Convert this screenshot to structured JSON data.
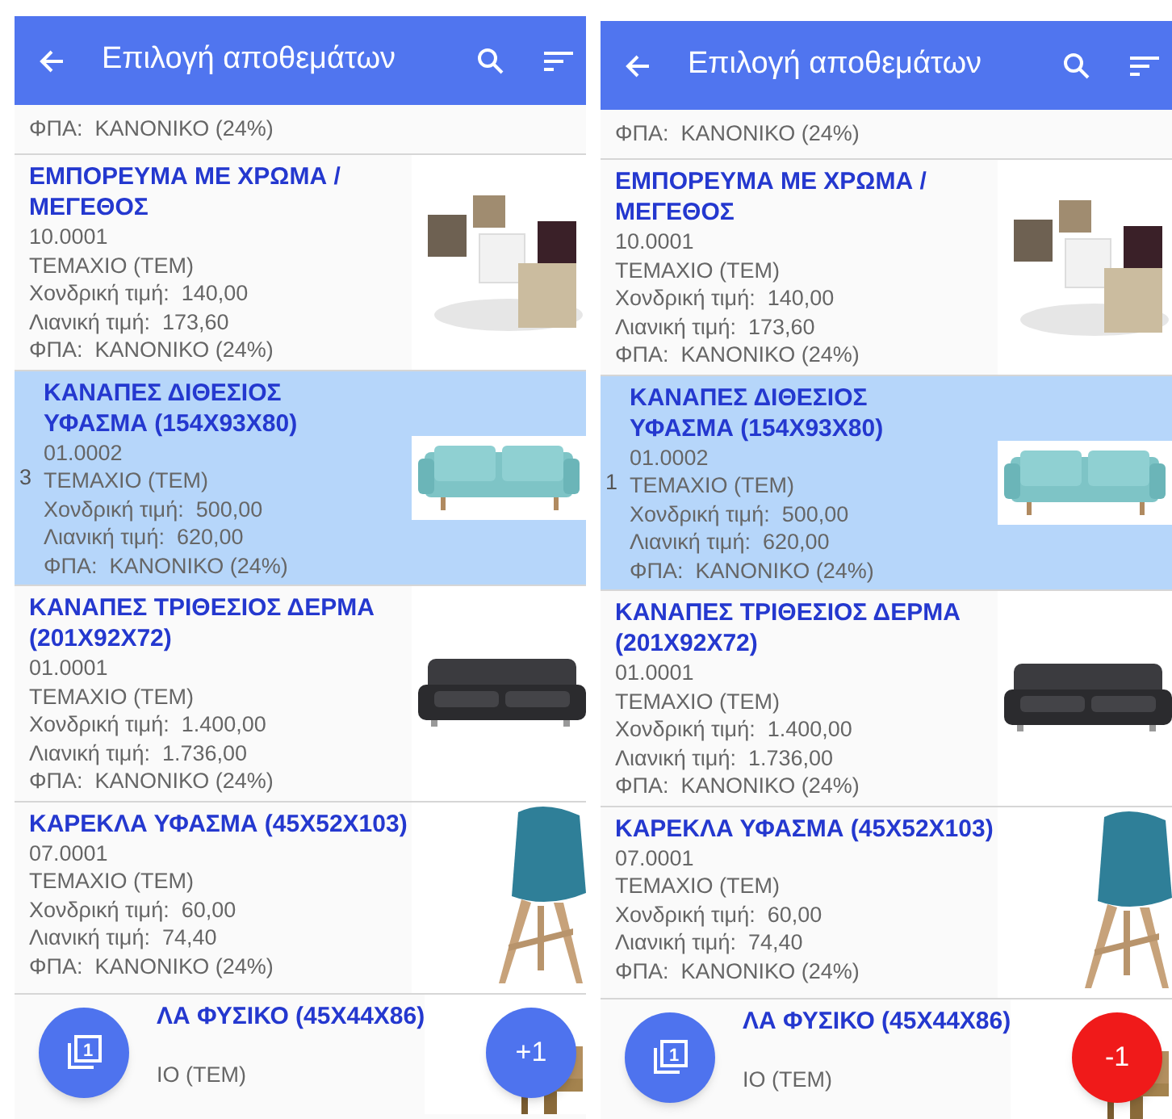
{
  "panels": [
    {
      "title": "Επιλογή αποθεμάτων",
      "top_fragment": "ΦΠΑ:  ΚΑΝΟΝΙΚΟ (24%)",
      "items": [
        {
          "title": "ΕΜΠΟΡΕΥΜΑ ΜΕ ΧΡΩΜΑ / ΜΕΓΕΘΟΣ",
          "code": "10.0001",
          "unit": "ΤΕΜΑΧΙΟ (ΤΕΜ)",
          "wholesale": "Χονδρική τιμή:  140,00",
          "retail": "Λιανική τιμή:  173,60",
          "vat": "ΦΠΑ:  ΚΑΝΟΝΙΚΟ (24%)",
          "selected": false
        },
        {
          "title": "ΚΑΝΑΠΕΣ ΔΙΘΕΣΙΟΣ ΥΦΑΣΜΑ (154X93X80)",
          "code": "01.0002",
          "unit": "ΤΕΜΑΧΙΟ (ΤΕΜ)",
          "wholesale": "Χονδρική τιμή:  500,00",
          "retail": "Λιανική τιμή:  620,00",
          "vat": "ΦΠΑ:  ΚΑΝΟΝΙΚΟ (24%)",
          "selected": true,
          "quantity": "3"
        },
        {
          "title": "ΚΑΝΑΠΕΣ ΤΡΙΘΕΣΙΟΣ ΔΕΡΜΑ (201X92X72)",
          "code": "01.0001",
          "unit": "ΤΕΜΑΧΙΟ (ΤΕΜ)",
          "wholesale": "Χονδρική τιμή:  1.400,00",
          "retail": "Λιανική τιμή:  1.736,00",
          "vat": "ΦΠΑ:  ΚΑΝΟΝΙΚΟ (24%)",
          "selected": false
        },
        {
          "title": "ΚΑΡΕΚΛΑ ΥΦΑΣΜΑ (45X52X103)",
          "code": "07.0001",
          "unit": "ΤΕΜΑΧΙΟ (ΤΕΜ)",
          "wholesale": "Χονδρική τιμή:  60,00",
          "retail": "Λιανική τιμή:  74,40",
          "vat": "ΦΠΑ:  ΚΑΝΟΝΙΚΟ (24%)",
          "selected": false
        }
      ],
      "last_fragment": {
        "title": "ΛΑ ΦΥΣΙΚΟ (45X44X86)",
        "unit": "ΙΟ (ΤΕΜ)"
      },
      "fab_left": {
        "icon_digit": "1"
      },
      "fab_right": {
        "label": "+1",
        "kind": "increment"
      }
    },
    {
      "title": "Επιλογή αποθεμάτων",
      "top_fragment": "ΦΠΑ:  ΚΑΝΟΝΙΚΟ (24%)",
      "items": [
        {
          "title": "ΕΜΠΟΡΕΥΜΑ ΜΕ ΧΡΩΜΑ / ΜΕΓΕΘΟΣ",
          "code": "10.0001",
          "unit": "ΤΕΜΑΧΙΟ (ΤΕΜ)",
          "wholesale": "Χονδρική τιμή:  140,00",
          "retail": "Λιανική τιμή:  173,60",
          "vat": "ΦΠΑ:  ΚΑΝΟΝΙΚΟ (24%)",
          "selected": false
        },
        {
          "title": "ΚΑΝΑΠΕΣ ΔΙΘΕΣΙΟΣ ΥΦΑΣΜΑ (154X93X80)",
          "code": "01.0002",
          "unit": "ΤΕΜΑΧΙΟ (ΤΕΜ)",
          "wholesale": "Χονδρική τιμή:  500,00",
          "retail": "Λιανική τιμή:  620,00",
          "vat": "ΦΠΑ:  ΚΑΝΟΝΙΚΟ (24%)",
          "selected": true,
          "quantity": "1"
        },
        {
          "title": "ΚΑΝΑΠΕΣ ΤΡΙΘΕΣΙΟΣ ΔΕΡΜΑ (201X92X72)",
          "code": "01.0001",
          "unit": "ΤΕΜΑΧΙΟ (ΤΕΜ)",
          "wholesale": "Χονδρική τιμή:  1.400,00",
          "retail": "Λιανική τιμή:  1.736,00",
          "vat": "ΦΠΑ:  ΚΑΝΟΝΙΚΟ (24%)",
          "selected": false
        },
        {
          "title": "ΚΑΡΕΚΛΑ ΥΦΑΣΜΑ (45X52X103)",
          "code": "07.0001",
          "unit": "ΤΕΜΑΧΙΟ (ΤΕΜ)",
          "wholesale": "Χονδρική τιμή:  60,00",
          "retail": "Λιανική τιμή:  74,40",
          "vat": "ΦΠΑ:  ΚΑΝΟΝΙΚΟ (24%)",
          "selected": false
        }
      ],
      "last_fragment": {
        "title": "ΛΑ ΦΥΣΙΚΟ (45X44X86)",
        "unit": "ΙΟ (ΤΕΜ)"
      },
      "fab_left": {
        "icon_digit": "1"
      },
      "fab_right": {
        "label": "-1",
        "kind": "decrement"
      }
    }
  ]
}
